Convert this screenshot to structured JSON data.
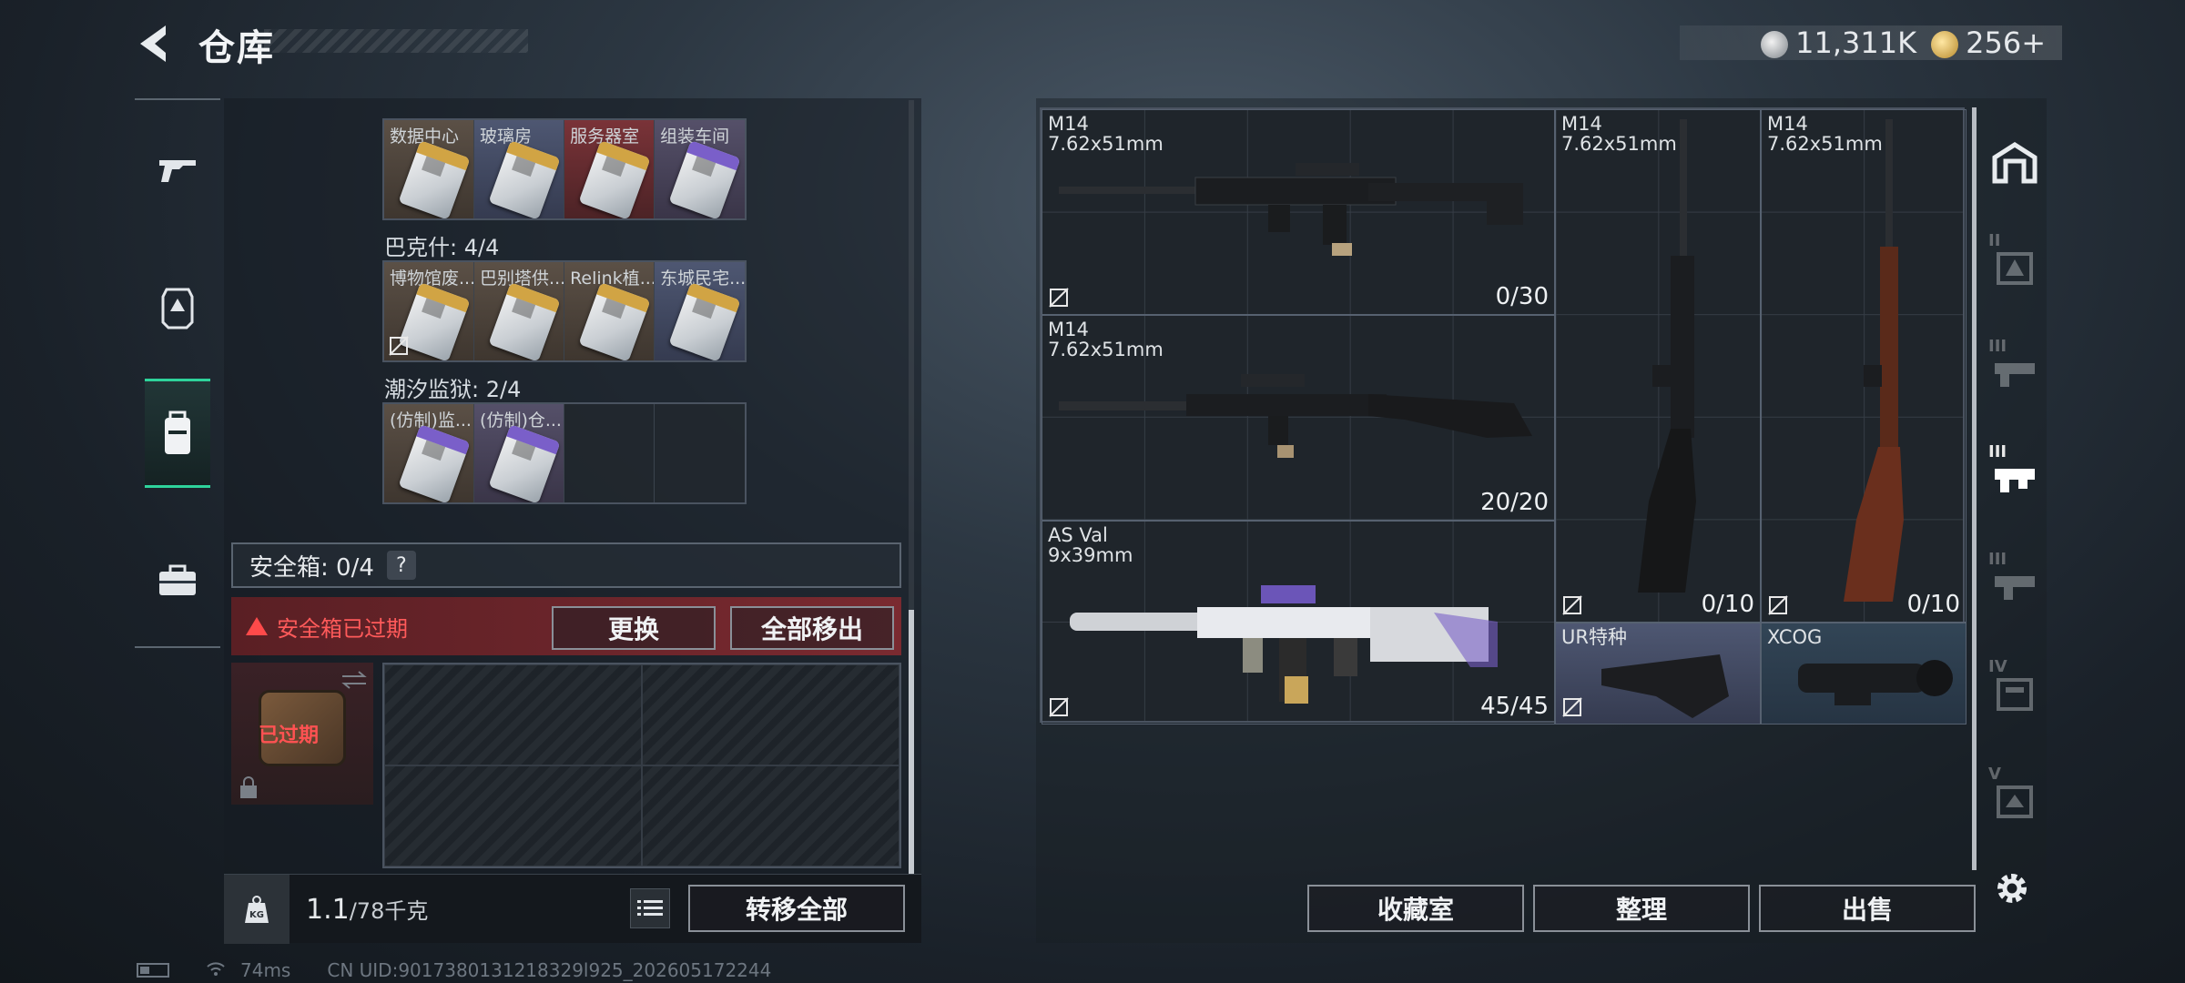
{
  "header": {
    "title": "仓库",
    "currency": [
      {
        "icon": "silver-coin-icon",
        "value": "11,311K"
      },
      {
        "icon": "gold-coin-icon",
        "value": "256+"
      }
    ]
  },
  "left_nav": [
    {
      "icon": "pistol-icon",
      "active": false
    },
    {
      "icon": "armor-icon",
      "active": false
    },
    {
      "icon": "backpack-icon",
      "active": true
    },
    {
      "icon": "briefcase-icon",
      "active": false
    }
  ],
  "keycard_groups": [
    {
      "label": "",
      "items": [
        {
          "name": "数据中心",
          "bg": "brown",
          "card": "gold"
        },
        {
          "name": "玻璃房",
          "bg": "blue",
          "card": "gold"
        },
        {
          "name": "服务器室",
          "bg": "red",
          "card": "gold"
        },
        {
          "name": "组装车间",
          "bg": "purple",
          "card": "purple"
        }
      ]
    },
    {
      "label": "巴克什: 4/4",
      "items": [
        {
          "name": "博物馆废...",
          "bg": "brown",
          "card": "gold",
          "no_sell": true
        },
        {
          "name": "巴别塔供...",
          "bg": "brown",
          "card": "gold"
        },
        {
          "name": "Relink植...",
          "bg": "brown",
          "card": "gold"
        },
        {
          "name": "东城民宅...",
          "bg": "blue",
          "card": "gold"
        }
      ]
    },
    {
      "label": "潮汐监狱: 2/4",
      "items": [
        {
          "name": "(仿制)监...",
          "bg": "brown",
          "card": "purple"
        },
        {
          "name": "(仿制)仓...",
          "bg": "purple",
          "card": "purple"
        },
        {
          "name": "",
          "bg": "empty"
        },
        {
          "name": "",
          "bg": "empty"
        }
      ]
    }
  ],
  "safe": {
    "label": "安全箱: 0/4",
    "help": "?",
    "expired_text": "安全箱已过期",
    "replace_label": "更换",
    "remove_all_label": "全部移出",
    "expired_badge": "已过期"
  },
  "bottom": {
    "weight_icon": "KG",
    "weight_current": "1.1",
    "weight_max": "/78千克",
    "transfer_all_label": "转移全部"
  },
  "stash_items": [
    {
      "name": "M14",
      "caliber": "7.62x51mm",
      "count": "0/30",
      "no_sell": true
    },
    {
      "name": "M14",
      "caliber": "7.62x51mm",
      "count": "20/20",
      "no_sell": false
    },
    {
      "name": "AS Val",
      "caliber": "9x39mm",
      "count": "45/45",
      "no_sell": true
    },
    {
      "name": "M14",
      "caliber": "7.62x51mm",
      "count": "0/10",
      "no_sell": true
    },
    {
      "name": "M14",
      "caliber": "7.62x51mm",
      "count": "0/10",
      "no_sell": true
    },
    {
      "name": "UR特种",
      "caliber": "",
      "count": "",
      "no_sell": true
    },
    {
      "name": "XCOG",
      "caliber": "",
      "count": "",
      "no_sell": false
    }
  ],
  "right_buttons": {
    "collection": "收藏室",
    "organize": "整理",
    "sell": "出售"
  },
  "right_nav": [
    {
      "icon": "home-storage-icon",
      "tier": ""
    },
    {
      "icon": "tier-2-storage-icon",
      "tier": "II"
    },
    {
      "icon": "tier-3-storage-icon",
      "tier": "III"
    },
    {
      "icon": "tier-3-storage-active-icon",
      "tier": "III"
    },
    {
      "icon": "tier-3-storage-alt-icon",
      "tier": "III"
    },
    {
      "icon": "tier-4-storage-icon",
      "tier": "IV"
    },
    {
      "icon": "tier-5-storage-icon",
      "tier": "V"
    }
  ],
  "status": {
    "ping": "74ms",
    "uid": "CN UID:9017380131218329l925_202605172244"
  }
}
